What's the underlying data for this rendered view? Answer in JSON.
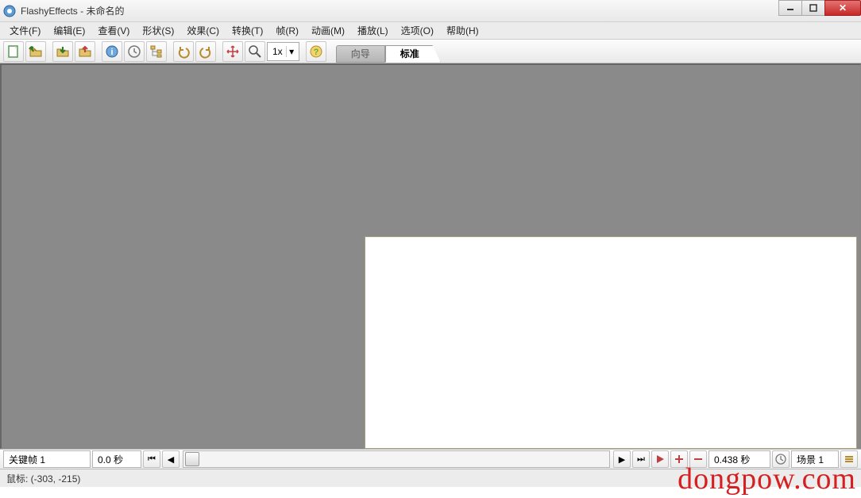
{
  "window": {
    "title": "FlashyEffects - 未命名的"
  },
  "menu": {
    "items": [
      "文件(F)",
      "编辑(E)",
      "查看(V)",
      "形状(S)",
      "效果(C)",
      "转换(T)",
      "帧(R)",
      "动画(M)",
      "播放(L)",
      "选项(O)",
      "帮助(H)"
    ]
  },
  "toolbar": {
    "zoom": "1x",
    "tabs": {
      "wizard": "向导",
      "standard": "标准"
    }
  },
  "bottom": {
    "keyframe": "关键帧 1",
    "time": "0.0 秒",
    "duration": "0.438 秒",
    "scene": "场景 1"
  },
  "status": {
    "mouse": "鼠标: (-303, -215)"
  },
  "watermark": "dongpow.com"
}
